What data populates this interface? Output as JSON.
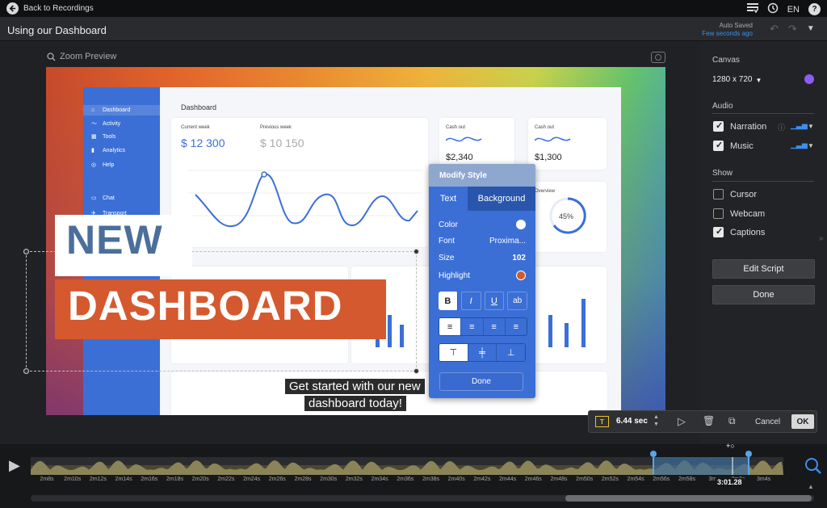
{
  "topbar": {
    "back_label": "Back to Recordings",
    "lang": "EN"
  },
  "header": {
    "title": "Using our Dashboard",
    "saved_line1": "Auto Saved",
    "saved_line2": "Few seconds ago"
  },
  "preview": {
    "zoom_label": "Zoom Preview"
  },
  "dashboard": {
    "title": "Dashboard",
    "sidebar": [
      "Dashboard",
      "Activity",
      "Tools",
      "Analytics",
      "Help",
      "Chat",
      "Transport"
    ],
    "current_week_label": "Current week",
    "current_week_value": "$ 12 300",
    "previous_week_label": "Previous week",
    "previous_week_value": "$ 10 150",
    "cash_out_label": "Cash out",
    "cash_out_1": "$2,340",
    "cash_out_2": "$1,300",
    "overview_label": "Overview",
    "overview_pct": "45%"
  },
  "overlay": {
    "new_text": "NEW",
    "dashboard_text": "DASHBOARD",
    "caption_line1": "Get started with our new",
    "caption_line2": "dashboard today!"
  },
  "modify_style": {
    "title": "Modify Style",
    "tab_text": "Text",
    "tab_background": "Background",
    "color_label": "Color",
    "font_label": "Font",
    "font_value": "Proxima...",
    "size_label": "Size",
    "size_value": "102",
    "highlight_label": "Highlight",
    "done_label": "Done"
  },
  "right_panel": {
    "canvas_label": "Canvas",
    "canvas_size": "1280 x 720",
    "audio_label": "Audio",
    "narration_label": "Narration",
    "music_label": "Music",
    "show_label": "Show",
    "cursor_label": "Cursor",
    "webcam_label": "Webcam",
    "captions_label": "Captions",
    "edit_script_label": "Edit Script",
    "done_label": "Done",
    "accent_color": "#8b5cf6"
  },
  "clip_toolbar": {
    "duration": "6.44 sec",
    "cancel_label": "Cancel",
    "ok_label": "OK"
  },
  "timeline": {
    "current_time": "3:01.28",
    "ticks": [
      "2m8s",
      "2m10s",
      "2m12s",
      "2m14s",
      "2m16s",
      "2m18s",
      "2m20s",
      "2m22s",
      "2m24s",
      "2m26s",
      "2m28s",
      "2m30s",
      "2m32s",
      "2m34s",
      "2m36s",
      "2m38s",
      "2m40s",
      "2m42s",
      "2m44s",
      "2m46s",
      "2m48s",
      "2m50s",
      "2m52s",
      "2m54s",
      "2m56s",
      "2m58s",
      "3m",
      "3m2s",
      "3m4s"
    ]
  }
}
